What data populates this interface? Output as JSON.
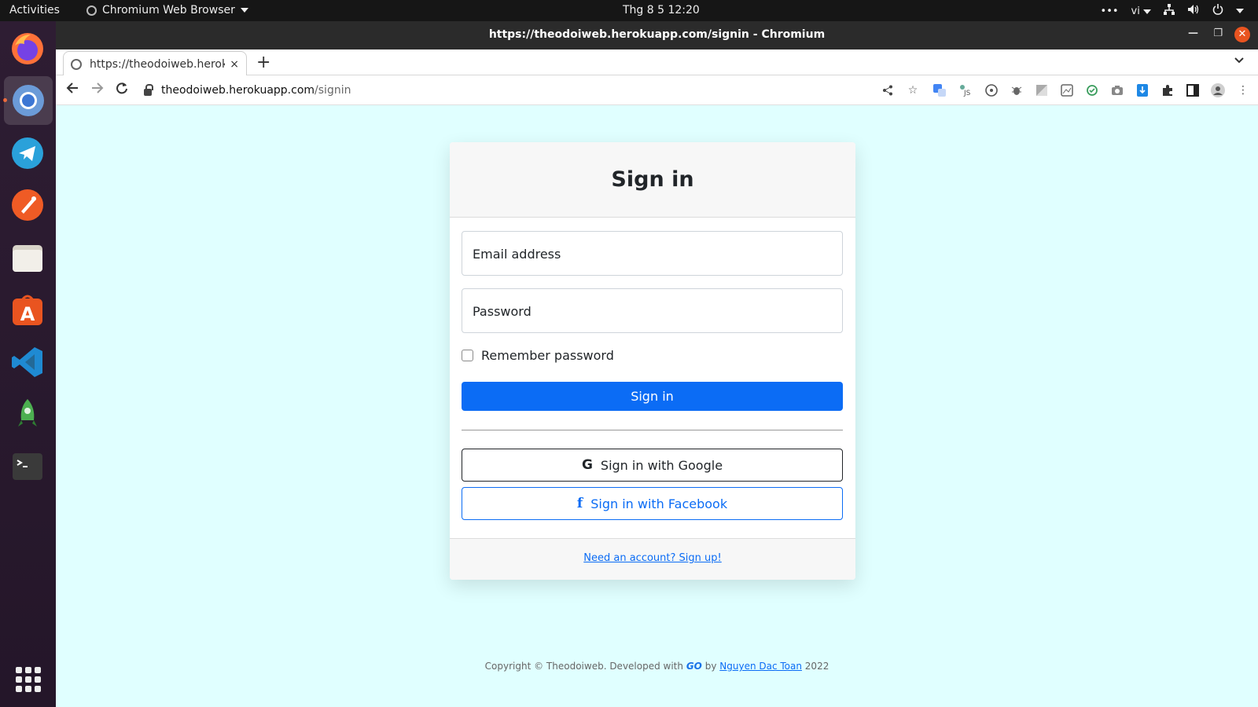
{
  "topbar": {
    "activities": "Activities",
    "app_name": "Chromium Web Browser",
    "clock": "Thg 8 5  12:20",
    "lang": "vi"
  },
  "dock": {
    "apps": [
      "firefox-icon",
      "chromium-icon",
      "telegram-icon",
      "postman-icon",
      "files-icon",
      "app-center-icon",
      "vscode-icon",
      "rocket-icon",
      "terminal-icon"
    ]
  },
  "window": {
    "title": "https://theodoiweb.herokuapp.com/signin - Chromium"
  },
  "tab": {
    "title": "https://theodoiweb.herokuapp.com/signin",
    "close": "×"
  },
  "newtab": "+",
  "url": {
    "host": "theodoiweb.herokuapp.com",
    "path": "/signin"
  },
  "card": {
    "title": "Sign in",
    "email_placeholder": "Email address",
    "password_placeholder": "Password",
    "remember": "Remember password",
    "signin_button": "Sign in",
    "google_button": "Sign in with Google",
    "google_icon": "G",
    "facebook_button": "Sign in with Facebook",
    "facebook_icon": "f",
    "signup_link": "Need an account? Sign up!"
  },
  "footer": {
    "prefix": "Copyright © Theodoiweb. Developed with",
    "go": "GO",
    "by": "by",
    "author": "Nguyen Dac Toan",
    "year": "2022"
  },
  "colors": {
    "page_bg": "#e0ffff",
    "primary": "#0b6cf5",
    "ubuntu_orange": "#e95420"
  }
}
